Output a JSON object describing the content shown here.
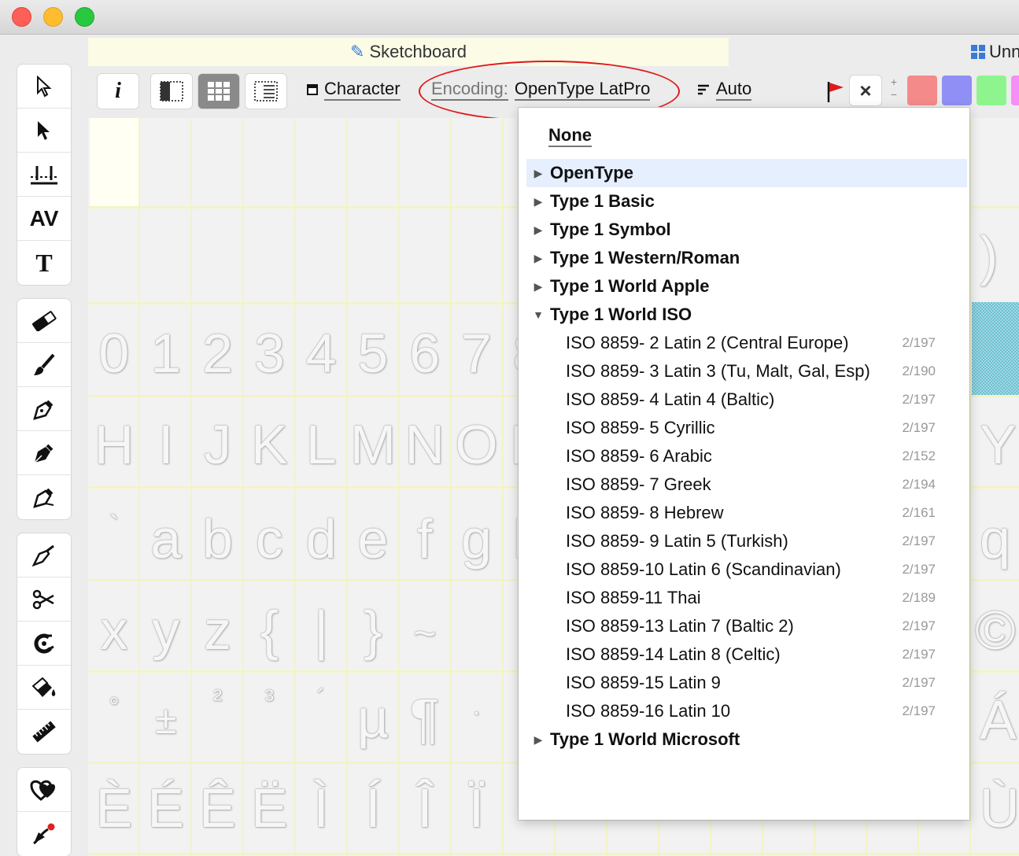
{
  "window": {
    "tabs": [
      {
        "label": "Sketchboard",
        "active": true
      },
      {
        "label": "Unn",
        "active": false
      }
    ]
  },
  "toolbar": {
    "info_label": "i",
    "character_label": "Character",
    "encoding_caption": "Encoding:",
    "encoding_value": "OpenType LatPro",
    "auto_label": "Auto",
    "close_label": "×",
    "plus_label": "+",
    "minus_label": "−",
    "swatch_colors": [
      "#f48a8a",
      "#8f8ff5",
      "#8ef58e",
      "#f58ef5"
    ]
  },
  "tools": {
    "group1": [
      "pointer-outline-icon",
      "pointer-solid-icon",
      "metrics-icon",
      "kerning-icon",
      "text-icon"
    ],
    "group2": [
      "eraser-icon",
      "brush-icon",
      "pen-icon",
      "calligraphy-pen-icon",
      "bezier-pen-icon"
    ],
    "group3": [
      "knife-icon",
      "scissors-icon",
      "magnet-icon",
      "paint-bucket-icon",
      "ruler-icon"
    ],
    "group4": [
      "hearts-icon",
      "bezier-curve-icon"
    ],
    "kerning_glyph": "AV",
    "text_glyph": "T"
  },
  "glyph_grid": {
    "row_digits": [
      "0",
      "1",
      "2",
      "3",
      "4",
      "5",
      "6",
      "7",
      "8"
    ],
    "row_caps": [
      "H",
      "I",
      "J",
      "K",
      "L",
      "M",
      "N",
      "O",
      "P"
    ],
    "row_lower": [
      "`",
      "a",
      "b",
      "c",
      "d",
      "e",
      "f",
      "g",
      "h"
    ],
    "row_braces": [
      "x",
      "y",
      "z",
      "{",
      "|",
      "}",
      "~"
    ],
    "row_symbols": [
      "°",
      "±",
      "²",
      "³",
      "´",
      "µ",
      "¶",
      "·"
    ],
    "row_accents": [
      "È",
      "É",
      "Ê",
      "Ë",
      "Ì",
      "Í",
      "Î",
      "Ï"
    ],
    "right_column": [
      ")",
      "Y",
      "q",
      "©",
      "Á",
      "Ù"
    ]
  },
  "encoding_menu": {
    "none_label": "None",
    "groups_before": [
      {
        "label": "OpenType",
        "expanded": false,
        "highlighted": true
      },
      {
        "label": "Type 1 Basic",
        "expanded": false
      },
      {
        "label": "Type 1 Symbol",
        "expanded": false
      },
      {
        "label": "Type 1 Western/Roman",
        "expanded": false
      },
      {
        "label": "Type 1 World Apple",
        "expanded": false
      },
      {
        "label": "Type 1 World ISO",
        "expanded": true
      }
    ],
    "iso_items": [
      {
        "name": "ISO 8859- 2 Latin 2 (Central Europe)",
        "count": "2/197"
      },
      {
        "name": "ISO 8859- 3 Latin 3 (Tu, Malt, Gal, Esp)",
        "count": "2/190"
      },
      {
        "name": "ISO 8859- 4 Latin 4 (Baltic)",
        "count": "2/197"
      },
      {
        "name": "ISO 8859- 5 Cyrillic",
        "count": "2/197"
      },
      {
        "name": "ISO 8859- 6 Arabic",
        "count": "2/152"
      },
      {
        "name": "ISO 8859- 7 Greek",
        "count": "2/194"
      },
      {
        "name": "ISO 8859- 8 Hebrew",
        "count": "2/161"
      },
      {
        "name": "ISO 8859- 9 Latin 5 (Turkish)",
        "count": "2/197"
      },
      {
        "name": "ISO 8859-10 Latin 6 (Scandinavian)",
        "count": "2/197"
      },
      {
        "name": "ISO 8859-11 Thai",
        "count": "2/189"
      },
      {
        "name": "ISO 8859-13 Latin 7 (Baltic 2)",
        "count": "2/197"
      },
      {
        "name": "ISO 8859-14 Latin 8 (Celtic)",
        "count": "2/197"
      },
      {
        "name": "ISO 8859-15 Latin 9",
        "count": "2/197"
      },
      {
        "name": "ISO 8859-16 Latin 10",
        "count": "2/197"
      }
    ],
    "groups_after": [
      {
        "label": "Type 1 World Microsoft",
        "expanded": false
      }
    ]
  }
}
